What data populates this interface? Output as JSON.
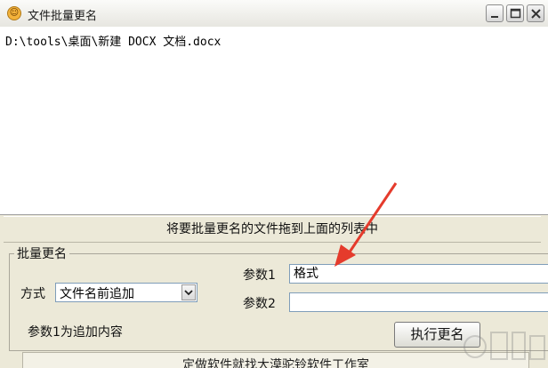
{
  "window": {
    "title": "文件批量更名",
    "icon": "app-face-icon",
    "controls": [
      "minimize-icon",
      "maximize-icon",
      "close-icon"
    ]
  },
  "file_list": {
    "items": [
      "D:\\tools\\桌面\\新建 DOCX 文档.docx"
    ]
  },
  "hint": "将要批量更名的文件拖到上面的列表中",
  "batch_group": {
    "legend": "批量更名",
    "mode_label": "方式",
    "mode_selected": "文件名前追加",
    "param1_label": "参数1",
    "param1_value": "格式",
    "param2_label": "参数2",
    "param2_value": "",
    "param_hint": "参数1为追加内容",
    "run_button": "执行更名"
  },
  "footer": "定做软件就找大漠驼铃软件工作室",
  "annotation": {
    "arrow_color": "#e53b2c"
  }
}
